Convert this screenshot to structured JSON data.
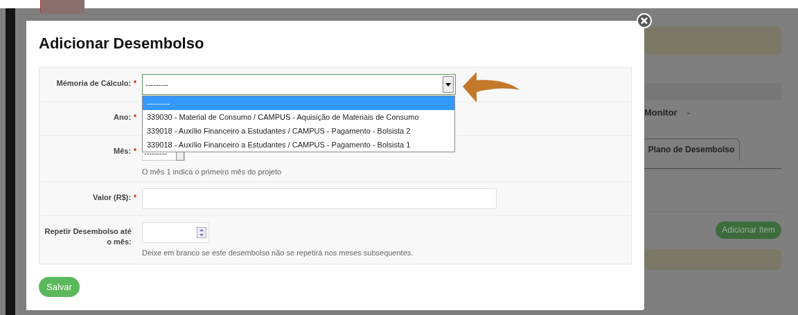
{
  "background": {
    "monitor_label": "Monitor",
    "monitor_value": "-",
    "tab": "Plano de Desembolso",
    "add_item_button": "Adicionar Item"
  },
  "modal": {
    "title": "Adicionar Desembolso",
    "fields": [
      {
        "kind": "select",
        "label": "Mémoria de Cálculo:",
        "required_mark": "*",
        "value": "---------",
        "focused": true,
        "options": [
          {
            "label": "---------",
            "selected": true
          },
          {
            "label": "339030 - Material de Consumo / CAMPUS - Aquisição de Materiais de Consumo",
            "selected": false
          },
          {
            "label": "339018 - Auxílio Financeiro a Estudantes / CAMPUS - Pagamento - Bolsista 2",
            "selected": false
          },
          {
            "label": "339018 - Auxílio Financeiro a Estudantes / CAMPUS - Pagamento - Bolsista 1",
            "selected": false
          }
        ]
      },
      {
        "kind": "covered",
        "label": "Ano:",
        "required_mark": "*"
      },
      {
        "kind": "small-select",
        "label": "Mês:",
        "required_mark": "*",
        "value": "---------",
        "help": "O mês 1 indica o primeiro mês do projeto"
      },
      {
        "kind": "text",
        "label": "Valor (R$):",
        "required_mark": "*"
      },
      {
        "kind": "number",
        "label": "Repetir Desembolso até o mês:",
        "help": "Deixe em branco se este desembolso não se repetirá nos meses subsequentes."
      }
    ],
    "save_button": "Salvar"
  }
}
